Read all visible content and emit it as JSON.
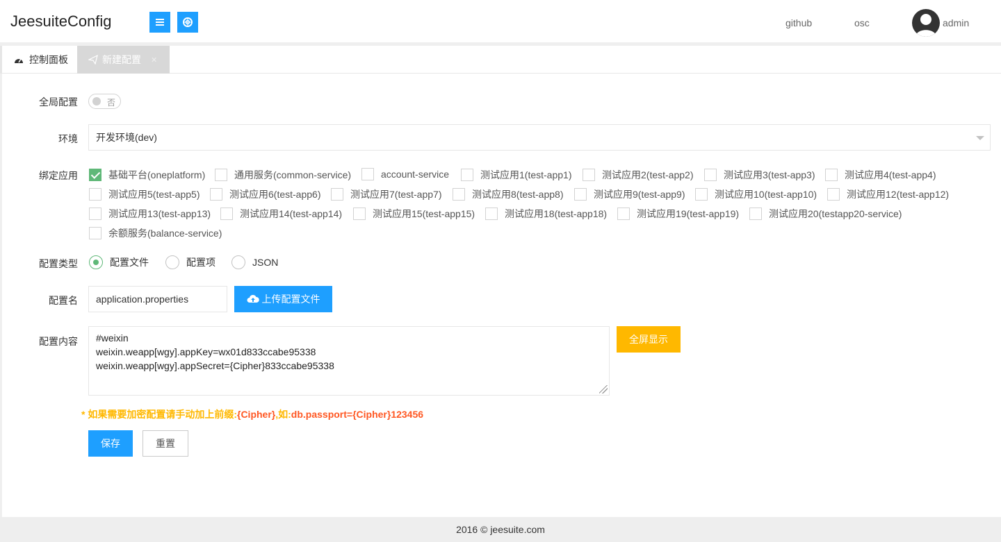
{
  "header": {
    "brand": "JeesuiteConfig",
    "menu_icon": "hamburger-icon",
    "help_icon": "lifebuoy-icon",
    "links": [
      "github",
      "osc"
    ],
    "user": "admin"
  },
  "tabs": {
    "dashboard": "控制面板",
    "new_config": "新建配置",
    "close": "✕"
  },
  "form": {
    "global_label": "全局配置",
    "global_toggle_text": "否",
    "env_label": "环境",
    "env_value": "开发环境(dev)",
    "apps_label": "绑定应用",
    "apps": [
      {
        "label": "基础平台(oneplatform)",
        "checked": true
      },
      {
        "label": "通用服务(common-service)",
        "checked": false
      },
      {
        "label": "account-service",
        "checked": false
      },
      {
        "label": "测试应用1(test-app1)",
        "checked": false
      },
      {
        "label": "测试应用2(test-app2)",
        "checked": false
      },
      {
        "label": "测试应用3(test-app3)",
        "checked": false
      },
      {
        "label": "测试应用4(test-app4)",
        "checked": false
      },
      {
        "label": "测试应用5(test-app5)",
        "checked": false
      },
      {
        "label": "测试应用6(test-app6)",
        "checked": false
      },
      {
        "label": "测试应用7(test-app7)",
        "checked": false
      },
      {
        "label": "测试应用8(test-app8)",
        "checked": false
      },
      {
        "label": "测试应用9(test-app9)",
        "checked": false
      },
      {
        "label": "测试应用10(test-app10)",
        "checked": false
      },
      {
        "label": "测试应用12(test-app12)",
        "checked": false
      },
      {
        "label": "测试应用13(test-app13)",
        "checked": false
      },
      {
        "label": "测试应用14(test-app14)",
        "checked": false
      },
      {
        "label": "测试应用15(test-app15)",
        "checked": false
      },
      {
        "label": "测试应用18(test-app18)",
        "checked": false
      },
      {
        "label": "测试应用19(test-app19)",
        "checked": false
      },
      {
        "label": "测试应用20(testapp20-service)",
        "checked": false
      },
      {
        "label": "余额服务(balance-service)",
        "checked": false
      }
    ],
    "type_label": "配置类型",
    "type_options": [
      "配置文件",
      "配置项",
      "JSON"
    ],
    "type_selected": "配置文件",
    "name_label": "配置名",
    "name_value": "application.properties",
    "upload_button": "上传配置文件",
    "content_label": "配置内容",
    "content_lines": [
      "#weixin",
      "weixin.weapp[wgy].appKey=wx01d833ccabe95338",
      "weixin.weapp[wgy].appSecret={Cipher}833ccabe95338"
    ],
    "fullscreen_button": "全屏显示",
    "tip_prefix": "* 如果需要加密配置请手动加上前缀:",
    "tip_cipher": "{Cipher}",
    "tip_mid": ",如:",
    "tip_example": "db.passport={Cipher}123456",
    "save_button": "保存",
    "reset_button": "重置"
  },
  "footer": "2016 ©  jeesuite.com",
  "colors": {
    "primary": "#1e9fff",
    "success": "#5fb878",
    "warning": "#ffb800",
    "danger": "#ff5722"
  }
}
